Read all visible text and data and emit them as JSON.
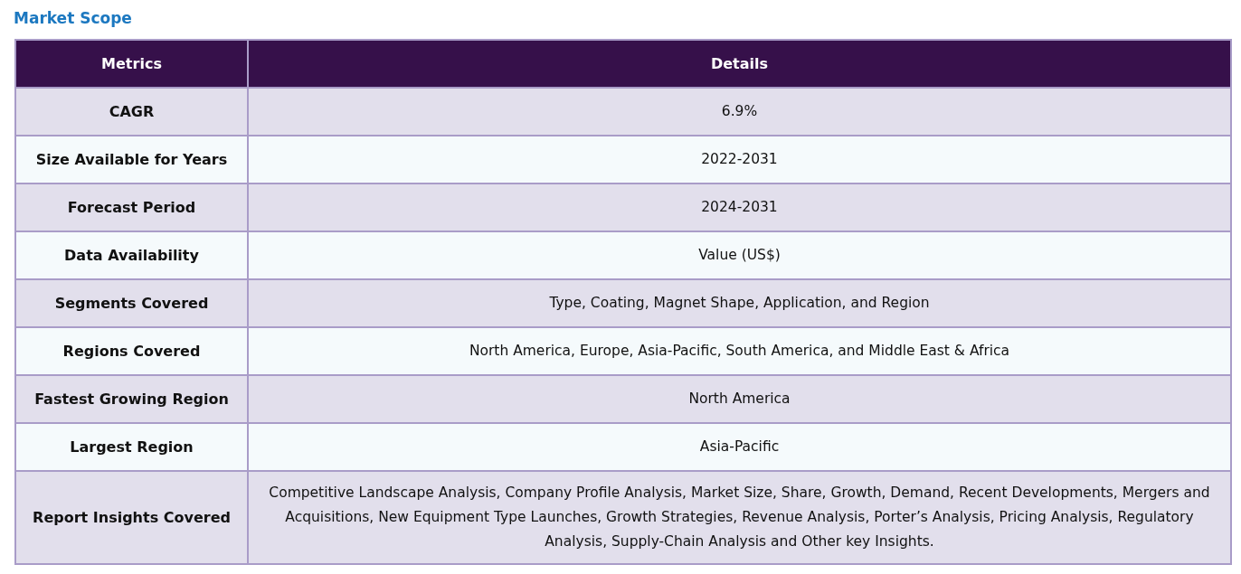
{
  "title": "Market Scope",
  "table": {
    "columns": [
      "Metrics",
      "Details"
    ],
    "rows": [
      {
        "metric": "CAGR",
        "detail": "6.9%"
      },
      {
        "metric": "Size Available for Years",
        "detail": "2022-2031"
      },
      {
        "metric": "Forecast Period",
        "detail": "2024-2031"
      },
      {
        "metric": "Data Availability",
        "detail": "Value (US$)"
      },
      {
        "metric": "Segments Covered",
        "detail": "Type, Coating, Magnet Shape, Application, and Region"
      },
      {
        "metric": "Regions Covered",
        "detail": "North America, Europe, Asia-Pacific, South America, and Middle East & Africa"
      },
      {
        "metric": "Fastest Growing Region",
        "detail": "North America"
      },
      {
        "metric": "Largest Region",
        "detail": "Asia-Pacific"
      },
      {
        "metric": "Report Insights Covered",
        "detail": "Competitive Landscape Analysis, Company Profile Analysis, Market Size, Share, Growth, Demand, Recent Developments, Mergers and Acquisitions, New Equipment Type Launches, Growth Strategies, Revenue Analysis, Porter’s Analysis, Pricing Analysis, Regulatory Analysis, Supply-Chain Analysis and Other key Insights."
      }
    ]
  }
}
